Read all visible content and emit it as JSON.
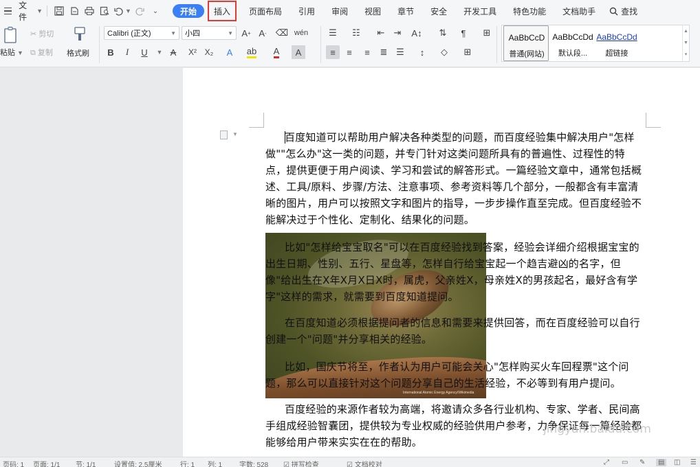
{
  "menubar": {
    "file_label": "文件",
    "tabs": [
      {
        "id": "start",
        "label": "开始"
      },
      {
        "id": "insert",
        "label": "插入"
      },
      {
        "id": "layout",
        "label": "页面布局"
      },
      {
        "id": "references",
        "label": "引用"
      },
      {
        "id": "review",
        "label": "审阅"
      },
      {
        "id": "view",
        "label": "视图"
      },
      {
        "id": "section",
        "label": "章节"
      },
      {
        "id": "security",
        "label": "安全"
      },
      {
        "id": "devtools",
        "label": "开发工具"
      },
      {
        "id": "features",
        "label": "特色功能"
      },
      {
        "id": "dochelper",
        "label": "文档助手"
      }
    ],
    "search_label": "查找",
    "highlight_color": "#e53935",
    "accent_color": "#3a7ff6"
  },
  "ribbon": {
    "paste": "粘贴",
    "cut": "剪切",
    "copy": "复制",
    "format_painter": "格式刷",
    "font_name": "Calibri (正文)",
    "font_size": "小四",
    "styles": [
      {
        "sample": "AaBbCcD",
        "name": "普通(网站)"
      },
      {
        "sample": "AaBbCcDd",
        "name": "默认段..."
      },
      {
        "sample": "AaBbCcDd",
        "name": "超链接"
      }
    ]
  },
  "document": {
    "paragraphs": [
      "百度知道可以帮助用户解决各种类型的问题，而百度经验集中解决用户\"怎样做\"\"怎么办\"这一类的问题，并专门针对这类问题所具有的普遍性、过程性的特点，提供更便于用户阅读、学习和尝试的解答形式。一篇经验文章中，通常包括概述、工具/原料、步骤/方法、注意事项、参考资料等几个部分，一般都含有丰富清晰的图片，用户可以按照文字和图片的指导，一步步操作直至完成。但百度经验不能解决过于个性化、定制化、结果化的问题。",
      "比如\"怎样给宝宝取名\"可以在百度经验找到答案，经验会详细介绍根据宝宝的出生日期、性别、五行、星盘等，怎样自行给宝宝起一个趋吉避凶的名字，但像\"给出生在X年X月X日X时，属虎，父亲姓X，母亲姓X的男孩起名，最好含有学字\"这样的需求，就需要到百度知道提问。",
      "在百度知道必须根据提问者的信息和需要来提供回答，而在百度经验可以自行创建一个\"问题\"并分享相关的经验。",
      "比如，国庆节将至，作者认为用户可能会关心\"怎样购买火车回程票\"这个问题，那么可以直接针对这个问题分享自己的生活经验，不必等到有用户提问。",
      "百度经验的来源作者较为高端，将邀请众多各行业机构、专家、学者、民间高手组成经验智囊团，提供较为专业权威的经验供用户参考，力争保证每一篇经验都能够给用户带来实实在在的帮助。"
    ],
    "image_credit": "International Atomic Energy Agency/Wikimedia"
  },
  "statusbar": {
    "page_code": "页码: 1",
    "pages": "页面: 1/1",
    "section": "节: 1/1",
    "setting": "设置值: 2.5厘米",
    "row": "行: 1",
    "col": "列: 1",
    "word_count": "字数: 528",
    "spell_check": "拼写检查",
    "doc_check": "文档校对"
  },
  "watermark": "jingyan.baidu.com"
}
